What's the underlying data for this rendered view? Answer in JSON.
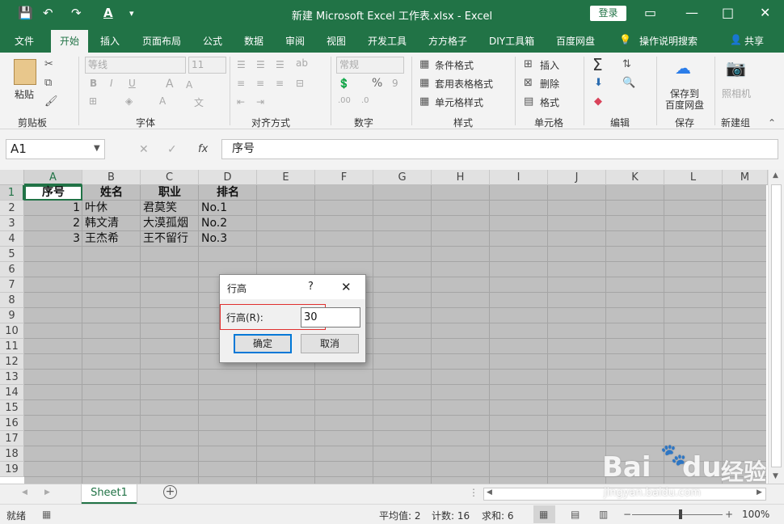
{
  "window": {
    "title": "新建 Microsoft Excel 工作表.xlsx  -  Excel",
    "login_label": "登录",
    "minimize": "—",
    "restore": "▭",
    "maximize": "□",
    "close": "✕"
  },
  "quick_access": {
    "save": "💾",
    "undo": "↶",
    "redo": "↷",
    "font_color": "A",
    "more": "▾"
  },
  "tabs": [
    {
      "label": "文件"
    },
    {
      "label": "开始"
    },
    {
      "label": "插入"
    },
    {
      "label": "页面布局"
    },
    {
      "label": "公式"
    },
    {
      "label": "数据"
    },
    {
      "label": "审阅"
    },
    {
      "label": "视图"
    },
    {
      "label": "开发工具"
    },
    {
      "label": "方方格子"
    },
    {
      "label": "DIY工具箱"
    },
    {
      "label": "百度网盘"
    },
    {
      "label": "操作说明搜索"
    },
    {
      "label": "共享"
    }
  ],
  "ribbon": {
    "clipboard": {
      "paste": "粘贴",
      "group": "剪贴板"
    },
    "font": {
      "name": "等线",
      "size": "11",
      "bold": "B",
      "italic": "I",
      "underline": "U",
      "grow": "A",
      "shrink": "A",
      "group": "字体"
    },
    "alignment": {
      "group": "对齐方式"
    },
    "number": {
      "format": "常规",
      "percent": "%",
      "comma": "9",
      "group": "数字"
    },
    "styles": {
      "conditional": "条件格式",
      "table": "套用表格格式",
      "cell": "单元格样式",
      "group": "样式"
    },
    "cells": {
      "insert": "插入",
      "delete": "删除",
      "format": "格式",
      "group": "单元格"
    },
    "editing": {
      "sum": "Σ",
      "group": "编辑"
    },
    "save": {
      "label1": "保存到",
      "label2": "百度网盘",
      "group": "保存"
    },
    "camera": {
      "label": "照相机",
      "group": "新建组"
    }
  },
  "formula_bar": {
    "name_box": "A1",
    "cancel": "✕",
    "enter": "✓",
    "fx": "fx",
    "content": "序号"
  },
  "columns": [
    "A",
    "B",
    "C",
    "D",
    "E",
    "F",
    "G",
    "H",
    "I",
    "J",
    "K",
    "L",
    "M"
  ],
  "rows": [
    "1",
    "2",
    "3",
    "4",
    "5",
    "6",
    "7",
    "8",
    "9",
    "10",
    "11",
    "12",
    "13",
    "14",
    "15",
    "16",
    "17",
    "18",
    "19"
  ],
  "table": {
    "headers": [
      "序号",
      "姓名",
      "职业",
      "排名"
    ],
    "rows": [
      [
        "1",
        "叶休",
        "君莫笑",
        "No.1"
      ],
      [
        "2",
        "韩文清",
        "大漠孤烟",
        "No.2"
      ],
      [
        "3",
        "王杰希",
        "王不留行",
        "No.3"
      ]
    ]
  },
  "sheet_tabs": {
    "active": "Sheet1",
    "add": "+"
  },
  "status_bar": {
    "mode": "就绪",
    "average": "平均值: 2",
    "count": "计数: 16",
    "sum": "求和: 6",
    "zoom": "100%",
    "zoom_minus": "−",
    "zoom_plus": "+"
  },
  "dialog": {
    "title": "行高",
    "help": "?",
    "close": "✕",
    "label": "行高(R):",
    "value": "30",
    "ok": "确定",
    "cancel": "取消"
  },
  "watermark": {
    "brand": "Bai",
    "brand2": "du",
    "suffix": "经验",
    "url": "jingyan.baidu.com"
  }
}
